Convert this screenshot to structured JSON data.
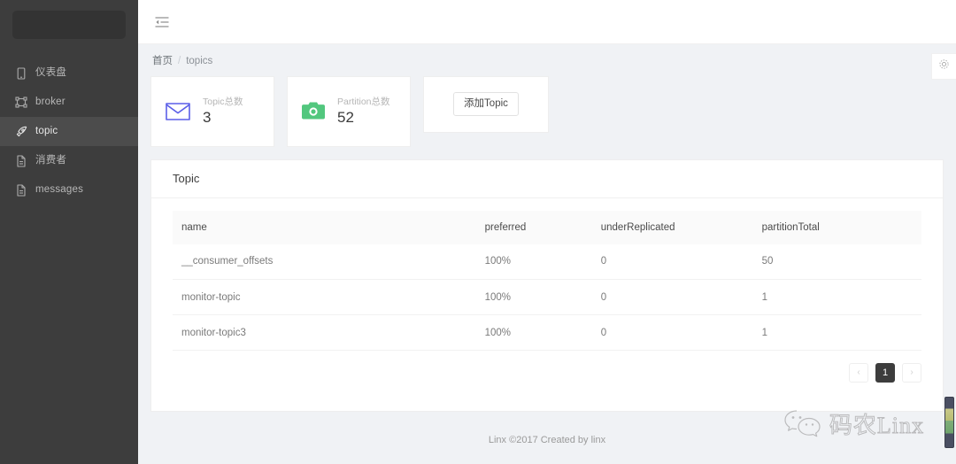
{
  "sidebar": {
    "logo_label": "",
    "items": [
      {
        "label": "仪表盘",
        "icon": "tablet-icon",
        "active": false
      },
      {
        "label": "broker",
        "icon": "cluster-icon",
        "active": false
      },
      {
        "label": "topic",
        "icon": "rocket-icon",
        "active": true
      },
      {
        "label": "消费者",
        "icon": "file-icon",
        "active": false
      },
      {
        "label": "messages",
        "icon": "file-icon",
        "active": false
      }
    ]
  },
  "topbar": {
    "menu_fold_icon": "menu-fold-icon"
  },
  "breadcrumb": {
    "home": "首页",
    "separator": "/",
    "current": "topics"
  },
  "cards": [
    {
      "title": "Topic总数",
      "value": "3",
      "icon": "envelope-icon",
      "color": "#5b5fe8"
    },
    {
      "title": "Partition总数",
      "value": "52",
      "icon": "camera-icon",
      "color": "#52c77e"
    }
  ],
  "actions": {
    "add_topic_label": "添加Topic"
  },
  "table": {
    "card_title": "Topic",
    "columns": [
      "name",
      "preferred",
      "underReplicated",
      "partitionTotal"
    ],
    "rows": [
      {
        "name": "__consumer_offsets",
        "preferred": "100%",
        "underReplicated": "0",
        "partitionTotal": "50"
      },
      {
        "name": "monitor-topic",
        "preferred": "100%",
        "underReplicated": "0",
        "partitionTotal": "1"
      },
      {
        "name": "monitor-topic3",
        "preferred": "100%",
        "underReplicated": "0",
        "partitionTotal": "1"
      }
    ]
  },
  "pagination": {
    "prev_label": "‹",
    "current_page": "1",
    "next_label": "›"
  },
  "footer": {
    "text": "Linx ©2017 Created by linx"
  },
  "settings_tab": {
    "icon": "gear-icon"
  },
  "watermark": {
    "icon": "wechat-icon",
    "text": "码农Linx"
  }
}
